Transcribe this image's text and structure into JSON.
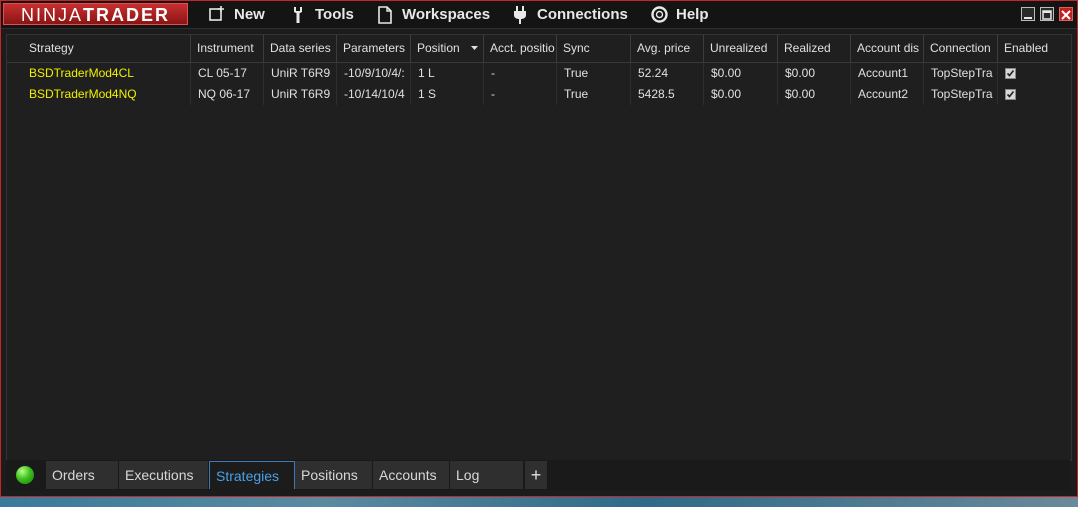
{
  "app": {
    "logo_light": "NINJA",
    "logo_bold": "TRADER"
  },
  "menu": {
    "new": "New",
    "tools": "Tools",
    "workspaces": "Workspaces",
    "connections": "Connections",
    "help": "Help"
  },
  "grid": {
    "columns": [
      "Strategy",
      "Instrument",
      "Data series",
      "Parameters",
      "Position",
      "Acct. positio",
      "Sync",
      "Avg. price",
      "Unrealized",
      "Realized",
      "Account dis",
      "Connection",
      "Enabled"
    ],
    "sorted_column": "Position",
    "rows": [
      {
        "strategy": "BSDTraderMod4CL",
        "instrument": "CL 05-17",
        "data_series": "UniR T6R9",
        "parameters": "-10/9/10/4/:",
        "position": "1 L",
        "acct_position": "-",
        "sync": "True",
        "avg_price": "52.24",
        "unrealized": "$0.00",
        "realized": "$0.00",
        "account": "Account1",
        "connection": "TopStepTra",
        "enabled": true
      },
      {
        "strategy": "BSDTraderMod4NQ",
        "instrument": "NQ 06-17",
        "data_series": "UniR T6R9",
        "parameters": "-10/14/10/4",
        "position": "1 S",
        "acct_position": "-",
        "sync": "True",
        "avg_price": "5428.5",
        "unrealized": "$0.00",
        "realized": "$0.00",
        "account": "Account2",
        "connection": "TopStepTra",
        "enabled": true
      }
    ]
  },
  "tabs": [
    {
      "label": "Orders",
      "active": false
    },
    {
      "label": "Executions",
      "active": false
    },
    {
      "label": "Strategies",
      "active": true
    },
    {
      "label": "Positions",
      "active": false
    },
    {
      "label": "Accounts",
      "active": false
    },
    {
      "label": "Log",
      "active": false
    }
  ],
  "tab_add_label": "+",
  "status": {
    "connection_color": "#3fc01e"
  },
  "colors": {
    "strategy_name": "#f0f000",
    "active_tab": "#4aa0e8",
    "window_border": "#c0282a"
  }
}
